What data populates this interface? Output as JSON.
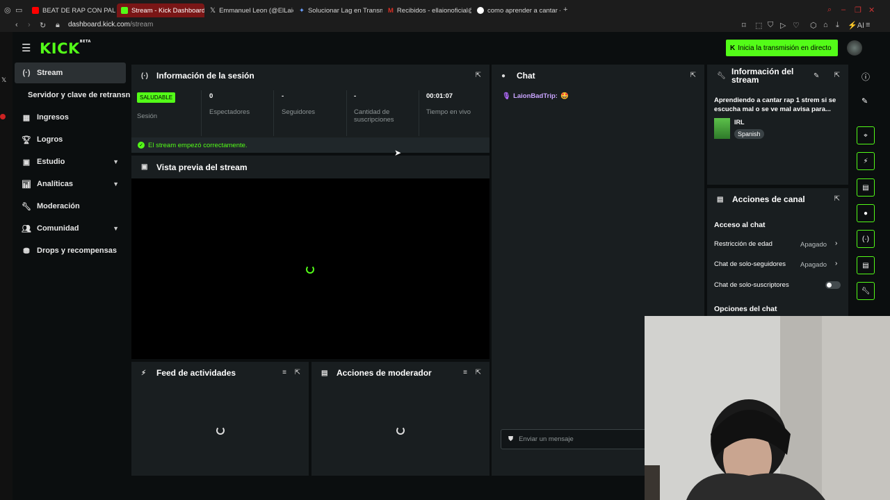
{
  "browser": {
    "tabs": [
      {
        "label": "BEAT DE RAP CON PALABR",
        "fav": "#ff0000"
      },
      {
        "label": "Stream - Kick Dashboard",
        "fav": "#53fc18"
      },
      {
        "label": "Emmanuel Leon (@ElLaion",
        "fav": "#000000"
      },
      {
        "label": "Solucionar Lag en Transm",
        "fav": "#6aa0ff"
      },
      {
        "label": "Recibidos - ellaionoficial@",
        "fav": "#d93025"
      },
      {
        "label": "como aprender a cantar - E",
        "fav": "#ffffff"
      }
    ],
    "url_host": "dashboard.kick.com",
    "url_path": "/stream",
    "ai_label": "AI"
  },
  "header": {
    "logo": "KICK",
    "logo_badge": "BETA",
    "go_live_label": "Inicia la transmisión en directo"
  },
  "sidebar": {
    "items": [
      {
        "label": "Stream",
        "icon": "broadcast-icon"
      },
      {
        "label": "Servidor y clave de retransn",
        "icon": ""
      },
      {
        "label": "Ingresos",
        "icon": "chart-icon"
      },
      {
        "label": "Logros",
        "icon": "trophy-icon"
      },
      {
        "label": "Estudio",
        "icon": "studio-icon"
      },
      {
        "label": "Analíticas",
        "icon": "analytics-icon"
      },
      {
        "label": "Moderación",
        "icon": "wrench-icon"
      },
      {
        "label": "Comunidad",
        "icon": "community-icon"
      },
      {
        "label": "Drops y recompensas",
        "icon": "drops-icon"
      }
    ]
  },
  "session": {
    "title": "Información de la sesión",
    "status_badge": "SALUDABLE",
    "status_label": "Sesión",
    "stats": [
      {
        "value": "0",
        "label": "Espectadores"
      },
      {
        "value": "-",
        "label": "Seguidores"
      },
      {
        "value": "-",
        "label": "Cantidad de suscripciones"
      },
      {
        "value": "00:01:07",
        "label": "Tiempo en vivo"
      }
    ],
    "success_message": "El stream empezó correctamente."
  },
  "preview": {
    "title": "Vista previa del stream"
  },
  "activity": {
    "title": "Feed de actividades"
  },
  "modactions": {
    "title": "Acciones de moderador"
  },
  "chat": {
    "title": "Chat",
    "messages": [
      {
        "user": "LaionBadTrip:",
        "emote": "🤩"
      }
    ],
    "input_placeholder": "Enviar un mensaje"
  },
  "stream_info": {
    "title": "Información del stream",
    "stream_title": "Aprendiendo a cantar rap 1 strem si se escucha mal o se ve mal avisa para...",
    "category": "IRL",
    "language": "Spanish"
  },
  "channel_actions": {
    "title": "Acciones de canal",
    "section_access": "Acceso al chat",
    "rows": [
      {
        "label": "Restricción de edad",
        "value": "Apagado"
      },
      {
        "label": "Chat de solo-seguidores",
        "value": "Apagado"
      },
      {
        "label": "Chat de solo-suscriptores",
        "value": ""
      }
    ],
    "section_options": "Opciones del chat"
  },
  "colors": {
    "accent": "#53fc18",
    "panel": "#191e20",
    "bg": "#0b0e0f"
  }
}
